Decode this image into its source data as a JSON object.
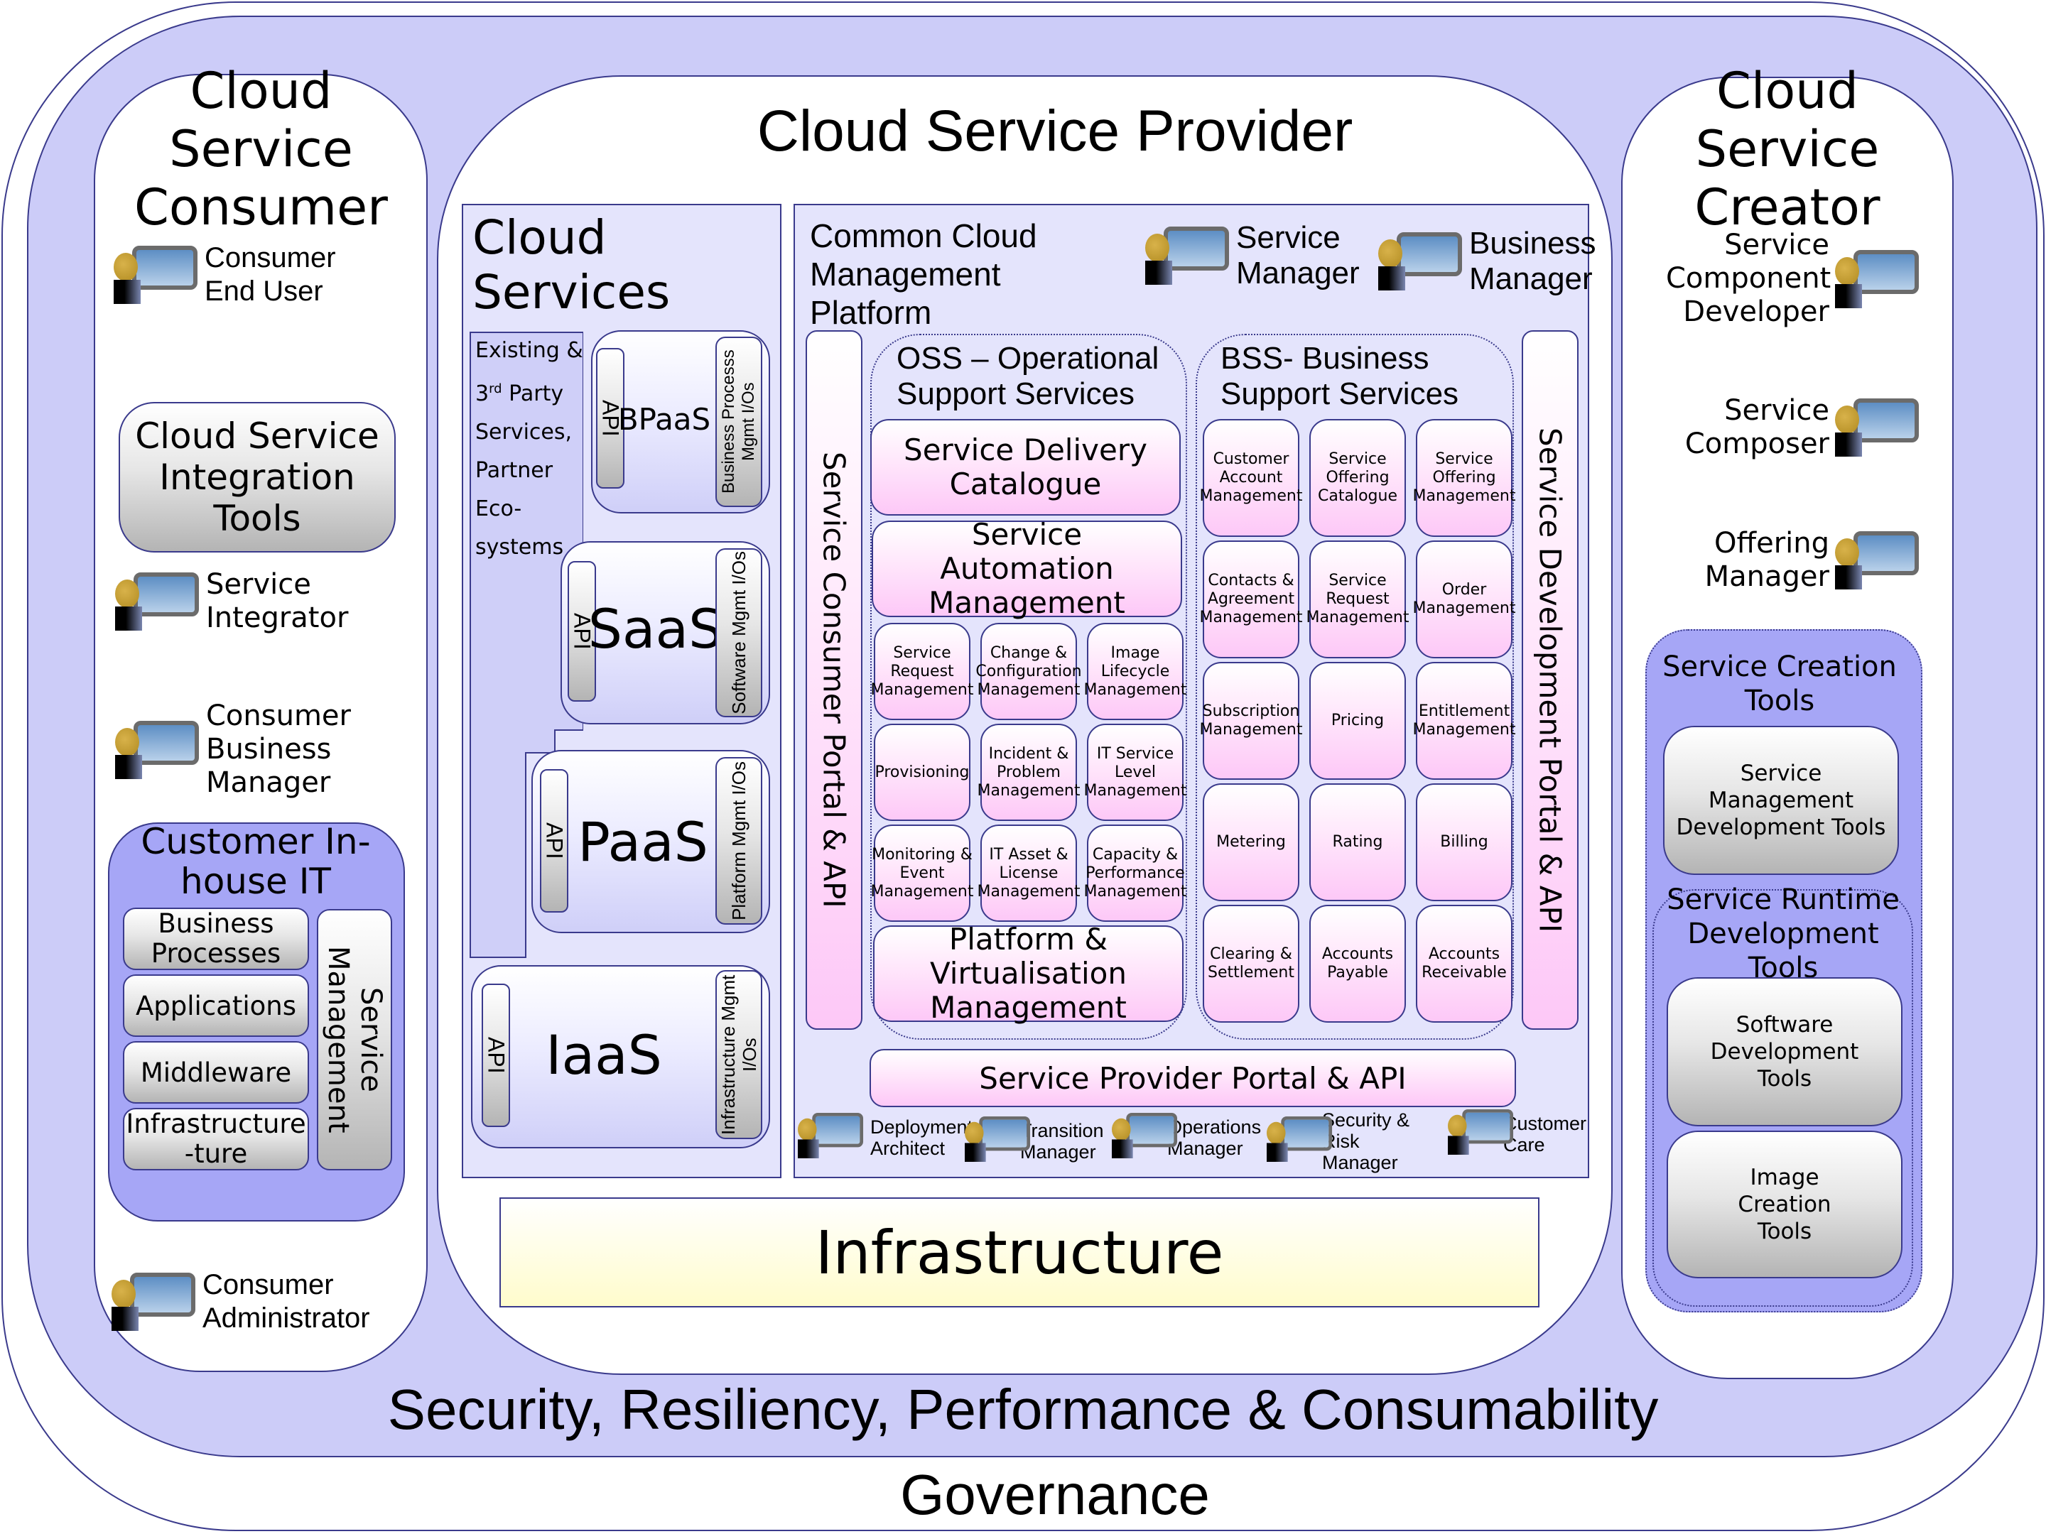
{
  "governance": "Governance",
  "cross_cutting": "Security, Resiliency, Performance & Consumability",
  "consumer": {
    "title": "Cloud Service Consumer",
    "roles": {
      "end_user": "Consumer End User",
      "integrator": "Service Integrator",
      "business_manager": "Consumer Business Manager",
      "administrator": "Consumer Administrator"
    },
    "integration_tools": "Cloud Service Integration Tools",
    "inhouse_it": {
      "title": "Customer In-house IT",
      "layers": [
        "Business Processes",
        "Applications",
        "Middleware",
        "Infrastructure -ture"
      ],
      "service_management": "Service Management"
    }
  },
  "provider": {
    "title": "Cloud Service Provider",
    "cloud_services": {
      "title": "Cloud Services",
      "existing": "Existing & 3rd Party Services, Partner Eco-systems",
      "existing_lines": [
        "Existing &",
        "3",
        "rd",
        " Party",
        "Services,",
        "Partner",
        "Eco-",
        "systems"
      ],
      "tiers": [
        {
          "name": "BPaaS",
          "api": "API",
          "mgmt": "Business Processs Mgmt I/Os"
        },
        {
          "name": "SaaS",
          "api": "API",
          "mgmt": "Software Mgmt I/Os"
        },
        {
          "name": "PaaS",
          "api": "API",
          "mgmt": "Platform Mgmt I/Os"
        },
        {
          "name": "IaaS",
          "api": "API",
          "mgmt": "Infrastructure Mgmt I/Os"
        }
      ]
    },
    "ccmp": {
      "title": "Common Cloud Management Platform",
      "managers": [
        "Service Manager",
        "Business Manager"
      ],
      "consumer_portal": "Service Consumer Portal & API",
      "development_portal": "Service Development Portal & API",
      "provider_portal": "Service Provider Portal & API",
      "oss": {
        "title": "OSS – Operational Support Services",
        "delivery_catalogue": "Service Delivery Catalogue",
        "automation": "Service Automation Management",
        "grid": [
          "Service Request Management",
          "Change & Configuration Management",
          "Image Lifecycle Management",
          "Provisioning",
          "Incident & Problem Management",
          "IT Service Level Management",
          "Monitoring & Event Management",
          "IT Asset & License Management",
          "Capacity & Performance Management"
        ],
        "platform": "Platform & Virtualisation Management"
      },
      "bss": {
        "title": "BSS- Business Support Services",
        "grid": [
          "Customer Account Management",
          "Service Offering Catalogue",
          "Service Offering Management",
          "Contacts & Agreement Management",
          "Service Request Management",
          "Order Management",
          "Subscription Management",
          "Pricing",
          "Entitlement Management",
          "Metering",
          "Rating",
          "Billing",
          "Clearing & Settlement",
          "Accounts Payable",
          "Accounts Receivable"
        ]
      },
      "roles": [
        "Deployment Architect",
        "Transition Manager",
        "Operations Manager",
        "Security & Risk Manager",
        "Customer Care"
      ]
    },
    "infrastructure": "Infrastructure"
  },
  "creator": {
    "title": "Cloud Service Creator",
    "roles": [
      "Service Component Developer",
      "Service Composer",
      "Offering Manager"
    ],
    "creation_tools": {
      "title": "Service Creation Tools",
      "mgmt_dev_tools": "Service Management Development Tools",
      "runtime": {
        "title": "Service Runtime Development Tools",
        "items": [
          "Software Development Tools",
          "Image Creation Tools"
        ]
      }
    }
  }
}
